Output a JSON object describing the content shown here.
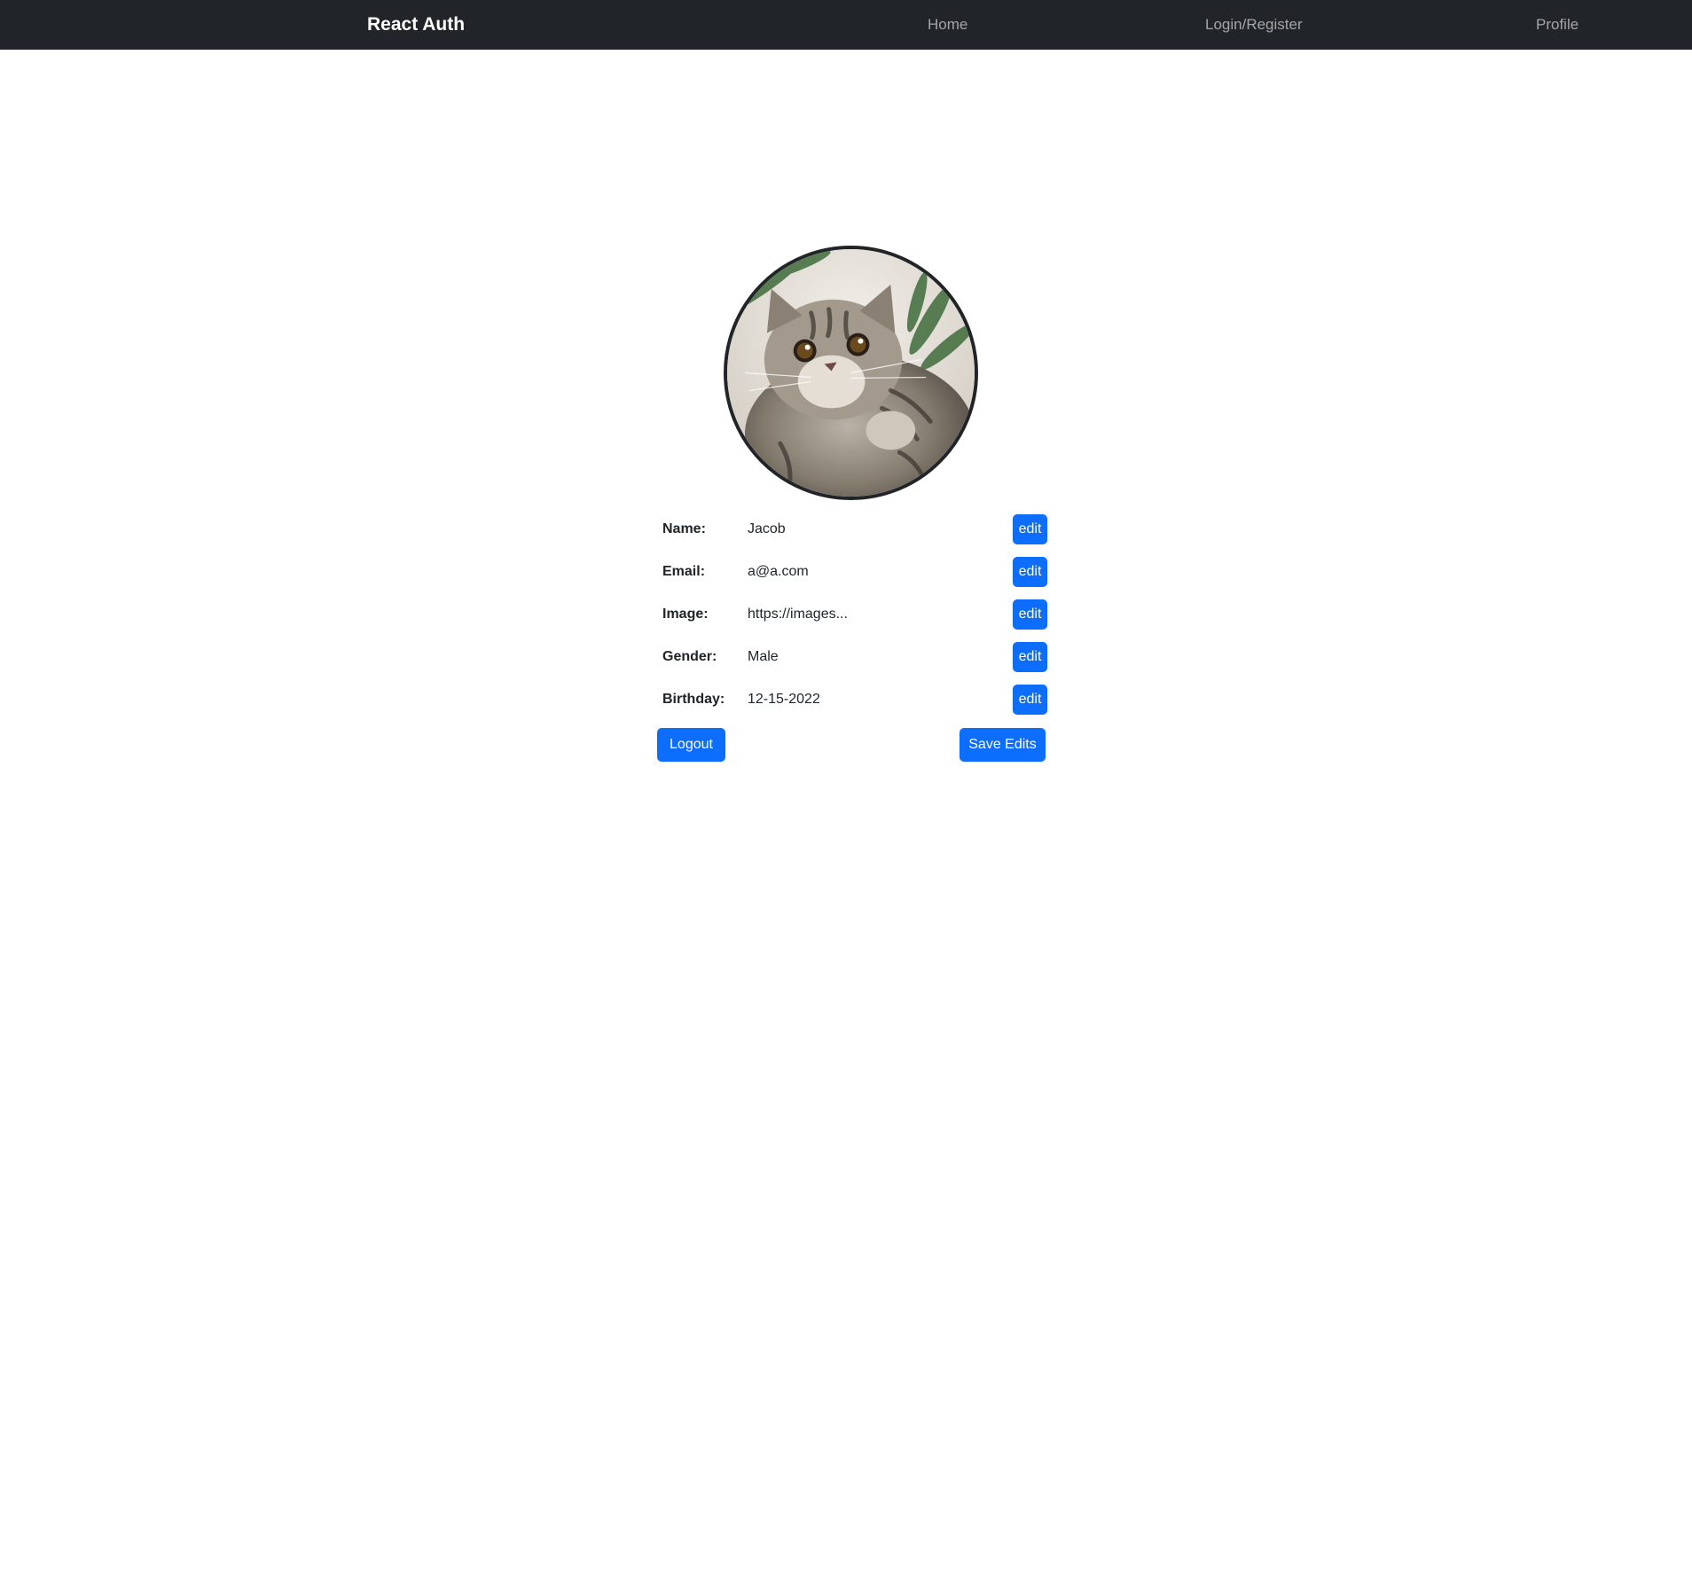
{
  "navbar": {
    "brand": "React Auth",
    "links": [
      "Home",
      "Login/Register",
      "Profile"
    ]
  },
  "profile": {
    "avatar_icon": "cat-photo-avatar",
    "fields": [
      {
        "label": "Name:",
        "value": "Jacob",
        "edit_label": "edit"
      },
      {
        "label": "Email:",
        "value": "a@a.com",
        "edit_label": "edit"
      },
      {
        "label": "Image:",
        "value": "https://images...",
        "edit_label": "edit"
      },
      {
        "label": "Gender:",
        "value": "Male",
        "edit_label": "edit"
      },
      {
        "label": "Birthday:",
        "value": "12-15-2022",
        "edit_label": "edit"
      }
    ]
  },
  "actions": {
    "logout_label": "Logout",
    "save_label": "Save Edits"
  },
  "colors": {
    "navbar_bg": "#212529",
    "primary": "#0d6efd",
    "text": "#212529"
  }
}
